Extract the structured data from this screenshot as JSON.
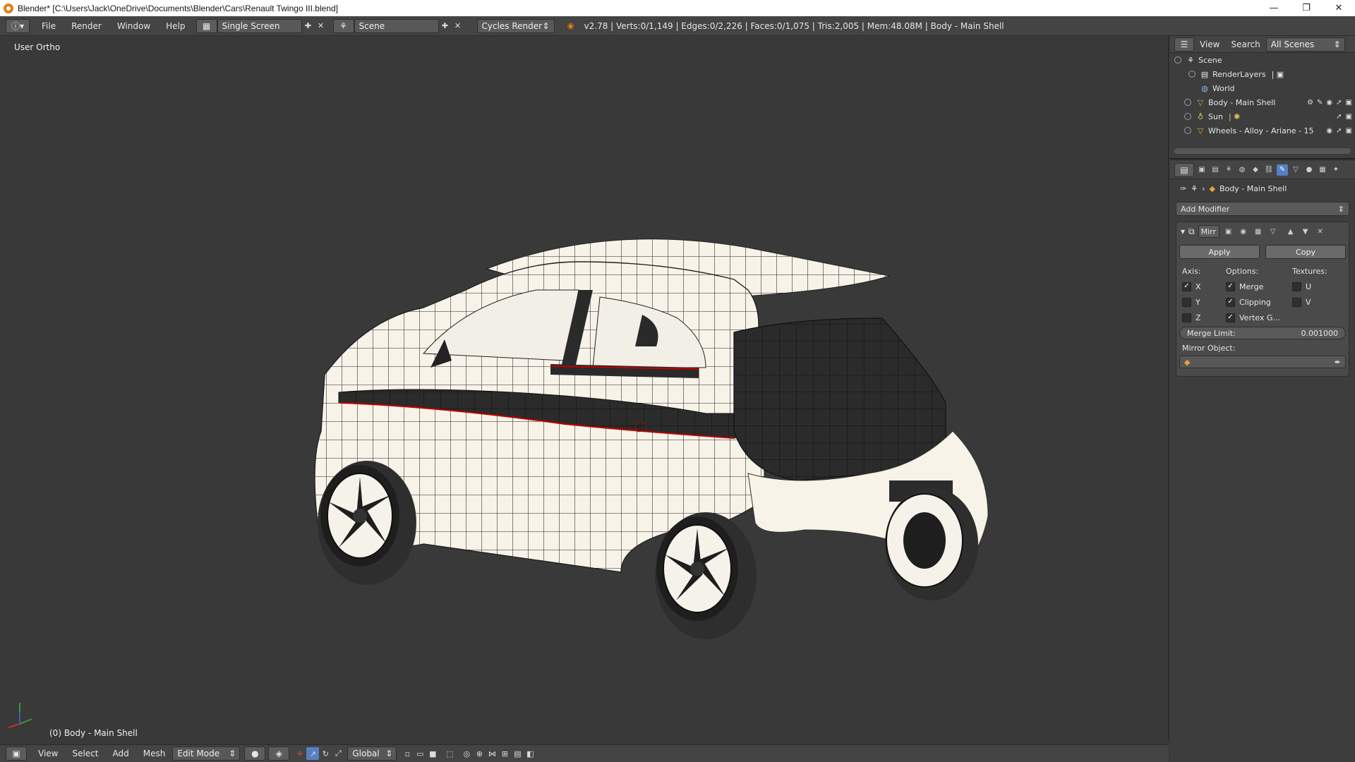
{
  "window": {
    "title": "Blender* [C:\\Users\\Jack\\OneDrive\\Documents\\Blender\\Cars\\Renault Twingo III.blend]",
    "minimize": "—",
    "maximize": "❐",
    "close": "✕"
  },
  "infobar": {
    "menus": [
      "File",
      "Render",
      "Window",
      "Help"
    ],
    "screen_layout": "Single Screen",
    "scene": "Scene",
    "render_engine": "Cycles Render",
    "stats": "v2.78 | Verts:0/1,149 | Edges:0/2,226 | Faces:0/1,075 | Tris:2,005 | Mem:48.08M | Body - Main Shell"
  },
  "viewport": {
    "view_label": "User Ortho",
    "object_label": "(0) Body - Main Shell"
  },
  "bottombar": {
    "menus": [
      "View",
      "Select",
      "Add",
      "Mesh"
    ],
    "mode": "Edit Mode",
    "orientation": "Global"
  },
  "outliner": {
    "header_view": "View",
    "header_search": "Search",
    "scenes_dropdown": "All Scenes",
    "items": [
      {
        "label": "Scene",
        "icon": "scene-icon"
      },
      {
        "label": "RenderLayers",
        "icon": "render-layers-icon"
      },
      {
        "label": "World",
        "icon": "world-icon"
      },
      {
        "label": "Body - Main Shell",
        "icon": "mesh-object-icon"
      },
      {
        "label": "Sun",
        "icon": "lamp-icon"
      },
      {
        "label": "Wheels - Alloy - Ariane - 15",
        "icon": "mesh-object-icon"
      }
    ]
  },
  "properties": {
    "breadcrumb": "Body - Main Shell",
    "add_modifier": "Add Modifier",
    "modifier": {
      "name": "Mirr",
      "apply": "Apply",
      "copy": "Copy",
      "axis_label": "Axis:",
      "options_label": "Options:",
      "textures_label": "Textures:",
      "axis": [
        {
          "label": "X",
          "checked": true
        },
        {
          "label": "Y",
          "checked": false
        },
        {
          "label": "Z",
          "checked": false
        }
      ],
      "options": [
        {
          "label": "Merge",
          "checked": true
        },
        {
          "label": "Clipping",
          "checked": true
        },
        {
          "label": "Vertex G...",
          "checked": true
        }
      ],
      "textures": [
        {
          "label": "U",
          "checked": false
        },
        {
          "label": "V",
          "checked": false
        }
      ],
      "merge_limit_label": "Merge Limit:",
      "merge_limit_value": "0.001000",
      "mirror_object_label": "Mirror Object:",
      "mirror_object_value": ""
    }
  },
  "colors": {
    "background": "#393939",
    "header": "#444444",
    "panel": "#3d3d3d",
    "active_tab": "#5680c2",
    "seam": "#c00000"
  }
}
